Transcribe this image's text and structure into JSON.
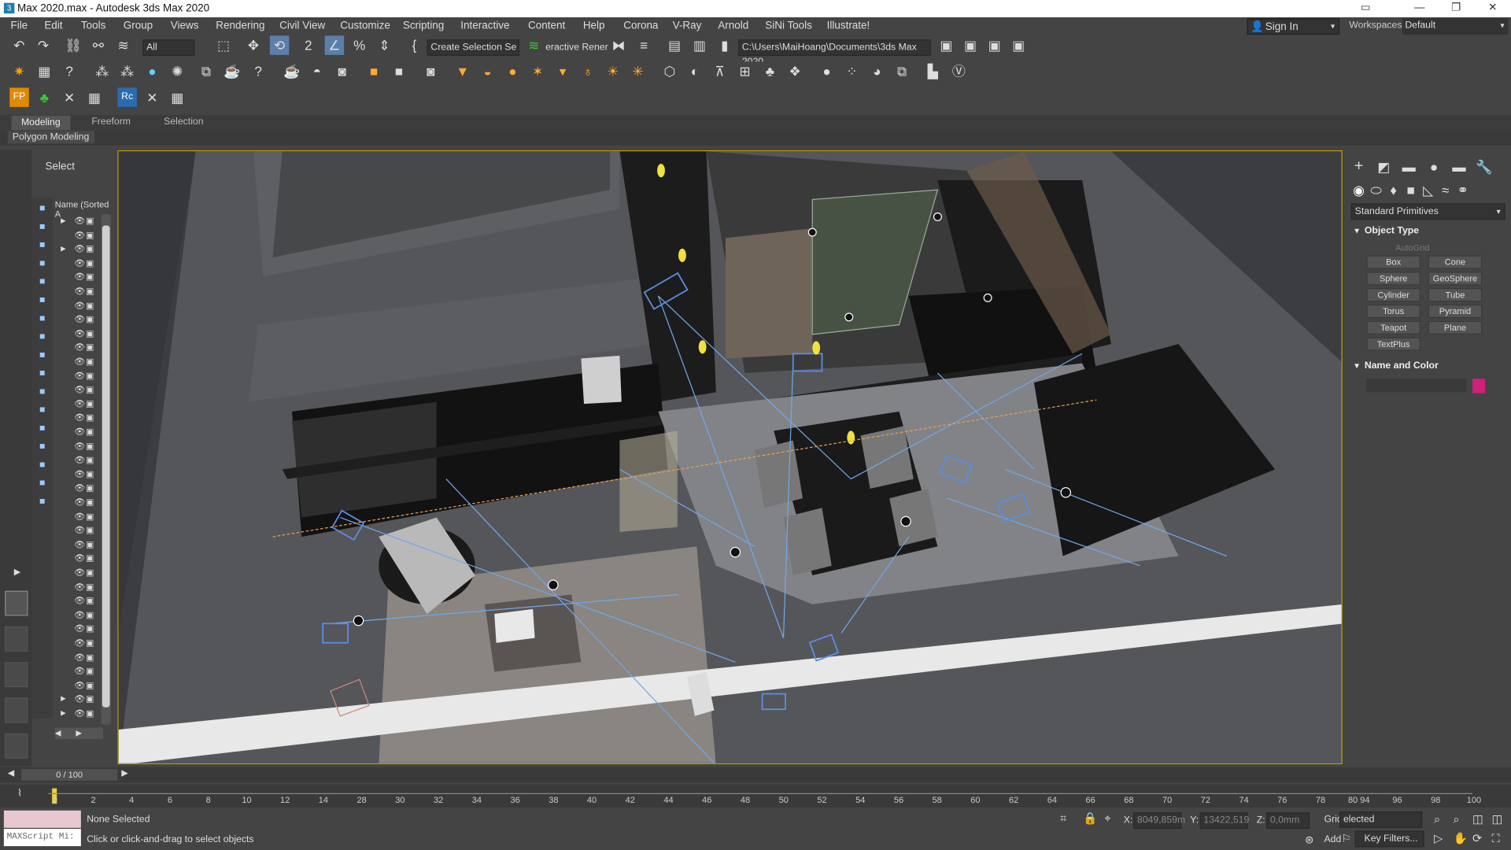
{
  "window": {
    "title": "Max 2020.max - Autodesk 3ds Max 2020"
  },
  "menu": [
    "File",
    "Edit",
    "Tools",
    "Group",
    "Views",
    "Rendering",
    "Civil View",
    "Customize",
    "Scripting",
    "Interactive",
    "Content",
    "Help",
    "Corona",
    "V-Ray",
    "Arnold",
    "SiNi Tools",
    "Illustrate!"
  ],
  "account": {
    "sign_in": "Sign In",
    "workspaces_label": "Workspaces:",
    "workspace": "Default"
  },
  "toolbar": {
    "filter": "All",
    "selection_set": "Create Selection Se",
    "interactive": "eractive Rener",
    "path": "C:\\Users\\MaiHoang\\Documents\\3ds Max 2020"
  },
  "ribbon": {
    "tabs": [
      "Modeling",
      "Freeform",
      "Selection"
    ],
    "panel": "Polygon Modeling"
  },
  "scene_explorer": {
    "title": "Select",
    "column": "Name (Sorted A"
  },
  "command_panel": {
    "category": "Standard Primitives",
    "object_type": "Object Type",
    "autogrid": "AutoGrid",
    "buttons": [
      "Box",
      "Cone",
      "Sphere",
      "GeoSphere",
      "Cylinder",
      "Tube",
      "Torus",
      "Pyramid",
      "Teapot",
      "Plane",
      "TextPlus"
    ],
    "name_color": "Name and Color",
    "color": "#d0207a"
  },
  "timeline": {
    "frame": "0 / 100",
    "ticks": [
      "0",
      "2",
      "4",
      "6",
      "8",
      "10",
      "12",
      "14",
      "28",
      "30",
      "32",
      "34",
      "36",
      "38",
      "40",
      "42",
      "44",
      "46",
      "48",
      "50",
      "52",
      "54",
      "56",
      "58",
      "60",
      "62",
      "64",
      "66",
      "68",
      "70",
      "72",
      "74",
      "76",
      "78",
      "80 94",
      "96",
      "98",
      "100"
    ]
  },
  "status": {
    "maxscript": "MAXScript Mi:",
    "selection": "None Selected",
    "prompt": "Click or click-and-drag to select objects",
    "x_label": "X:",
    "x": "8049,859m",
    "y_label": "Y:",
    "y": "13422,519",
    "z_label": "Z:",
    "z": "0,0mm",
    "grid": "Grid",
    "grid_value": "elected",
    "add": "Add",
    "key_filters": "Key Filters..."
  }
}
